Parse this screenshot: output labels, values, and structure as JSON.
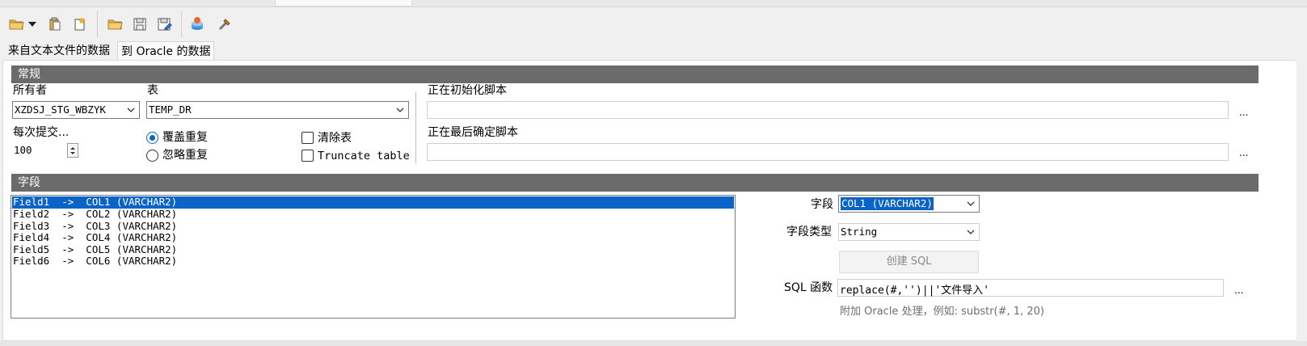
{
  "tabs": {
    "source_label": "来自文本文件的数据",
    "target_label": "到 Oracle 的数据"
  },
  "toolbar": {
    "icons": [
      "open-folder-dropdown-icon",
      "paste-icon",
      "new-icon",
      "open-icon",
      "save-icon",
      "save-as-icon",
      "run-icon",
      "tools-icon"
    ]
  },
  "general": {
    "heading": "常规",
    "owner_label": "所有者",
    "owner_value": "XZDSJ_STG_WBZYK",
    "table_label": "表",
    "table_value": "TEMP_DR",
    "commit_label": "每次提交...",
    "commit_value": "100",
    "radio_overwrite": "覆盖重复",
    "radio_ignore": "忽略重复",
    "check_clear": "清除表",
    "check_truncate": "Truncate table",
    "init_script_label": "正在初始化脚本",
    "final_script_label": "正在最后确定脚本",
    "ellipsis": "..."
  },
  "fields": {
    "heading": "字段",
    "list": [
      "Field1  ->  COL1 (VARCHAR2)",
      "Field2  ->  COL2 (VARCHAR2)",
      "Field3  ->  COL3 (VARCHAR2)",
      "Field4  ->  COL4 (VARCHAR2)",
      "Field5  ->  COL5 (VARCHAR2)",
      "Field6  ->  COL6 (VARCHAR2)"
    ],
    "field_label": "字段",
    "field_value": "COL1 (VARCHAR2)",
    "type_label": "字段类型",
    "type_value": "String",
    "create_sql_label": "创建 SQL",
    "sql_func_label": "SQL 函数",
    "sql_func_value": "replace(#,'')||'文件导入'",
    "hint": "附加 Oracle 处理，例如: substr(#, 1, 20)",
    "ellipsis": "..."
  },
  "colors": {
    "selection": "#0a64c8",
    "section_header": "#6b6b6b"
  }
}
